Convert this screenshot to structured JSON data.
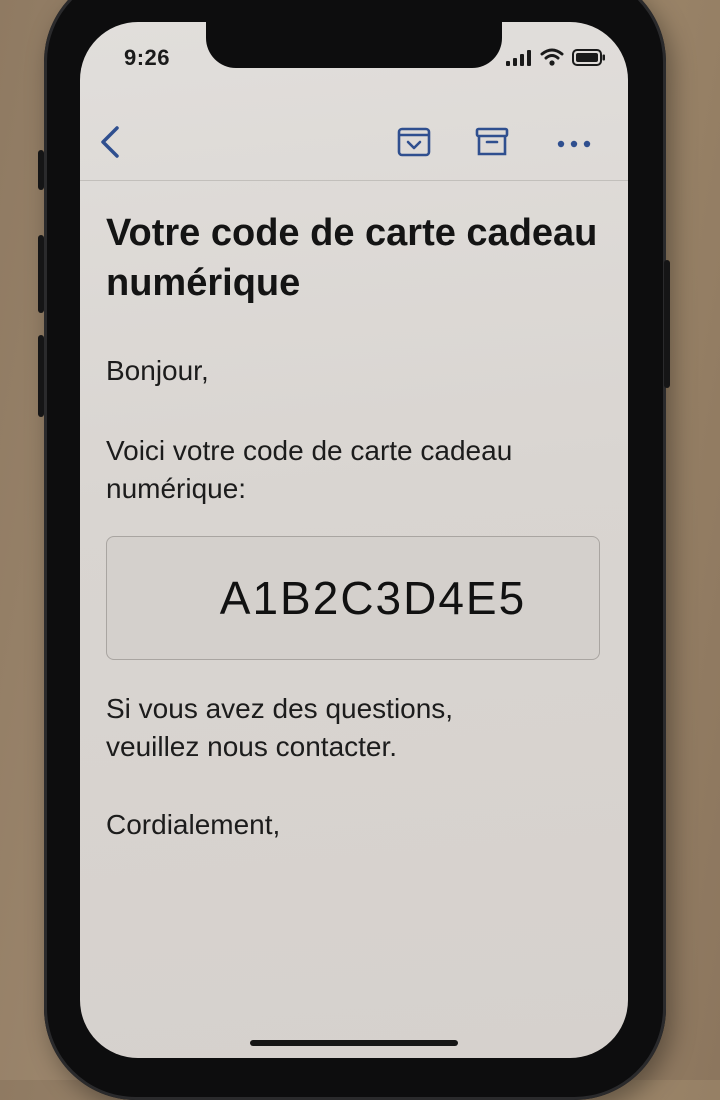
{
  "status_bar": {
    "time": "9:26"
  },
  "toolbar": {
    "back_icon": "chevron-left-icon",
    "move_icon": "tray-arrow-down-icon",
    "archive_icon": "archive-box-icon",
    "more_icon": "ellipsis-icon",
    "accent_color": "#2f4f8f"
  },
  "email": {
    "subject": "Votre code de carte cadeau numérique",
    "greeting": "Bonjour,",
    "intro_line_1": "Voici votre code de carte cadeau",
    "intro_line_2": "numérique:",
    "gift_code": "A1B2C3D4E5",
    "contact_line_1": "Si vous avez des questions,",
    "contact_line_2": "veuillez nous contacter.",
    "closing": "Cordialement,"
  }
}
